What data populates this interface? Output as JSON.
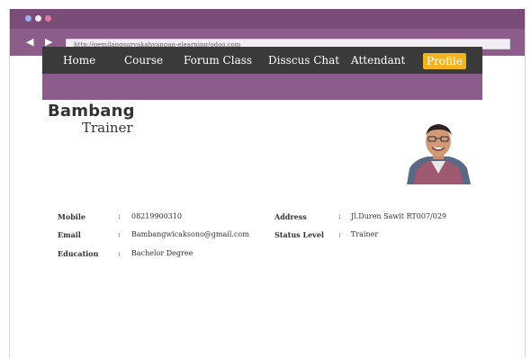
{
  "browser": {
    "back_icon": "arrow-left-icon",
    "forward_icon": "arrow-right-icon",
    "url": "http://gemilangsuryakahyangan-elearning/odoo.com"
  },
  "nav": {
    "items": [
      {
        "label": "Home"
      },
      {
        "label": "Course"
      },
      {
        "label": "Forum Class"
      },
      {
        "label": "Disscus Chat"
      },
      {
        "label": "Attendant"
      },
      {
        "label": "Profile",
        "active": true
      }
    ],
    "active_color": "#f2b320"
  },
  "profile": {
    "name": "Bambang",
    "role": "Trainer",
    "fields": {
      "mobile": {
        "label": "Mobile",
        "value": "08219900310"
      },
      "email": {
        "label": "Email",
        "value": "Bambangwicaksono@gmail.com"
      },
      "education": {
        "label": "Education",
        "value": "Bachelor Degree"
      },
      "address": {
        "label": "Address",
        "value": "Jl.Duren Sawit RT007/029"
      },
      "status_level": {
        "label": "Status Level",
        "value": "Trainer"
      }
    }
  },
  "colors": {
    "titlebar": "#7a4d78",
    "addressbar": "#8c5c8a",
    "menubar": "#3a3a3a",
    "strip": "#8b5c8c"
  }
}
